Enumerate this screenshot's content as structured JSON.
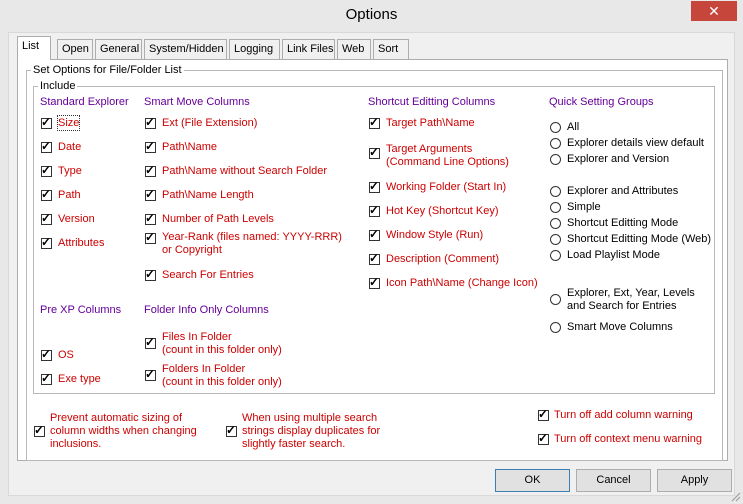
{
  "window": {
    "title": "Options",
    "close_glyph": "✕"
  },
  "tabs": [
    "List",
    "Open",
    "General",
    "System/Hidden",
    "Logging",
    "Link Files",
    "Web",
    "Sort"
  ],
  "group": {
    "title": "Set Options for File/Folder List",
    "include_title": "Include"
  },
  "standard_explorer": {
    "header": "Standard Explorer",
    "items": [
      {
        "label": "Size",
        "checked": true
      },
      {
        "label": "Date",
        "checked": true
      },
      {
        "label": "Type",
        "checked": true
      },
      {
        "label": "Path",
        "checked": true
      },
      {
        "label": "Version",
        "checked": true
      },
      {
        "label": "Attributes",
        "checked": true
      }
    ]
  },
  "smart_move": {
    "header": "Smart Move Columns",
    "items": [
      {
        "label": "Ext (File Extension)",
        "checked": true
      },
      {
        "label": "Path\\Name",
        "checked": true
      },
      {
        "label": "Path\\Name without Search Folder",
        "checked": true
      },
      {
        "label": "Path\\Name Length",
        "checked": true
      },
      {
        "label": "Number of Path Levels",
        "checked": true
      },
      {
        "label": "Year-Rank (files named: YYYY-RRR)",
        "label2": "or Copyright",
        "checked": true
      },
      {
        "label": "Search For Entries",
        "checked": true
      }
    ]
  },
  "shortcut_editing": {
    "header": "Shortcut Editting Columns",
    "items": [
      {
        "label": "Target Path\\Name",
        "checked": true
      },
      {
        "label": "Target Arguments",
        "label2": "(Command Line Options)",
        "checked": true
      },
      {
        "label": "Working Folder (Start In)",
        "checked": true
      },
      {
        "label": "Hot Key (Shortcut Key)",
        "checked": true
      },
      {
        "label": "Window Style (Run)",
        "checked": true
      },
      {
        "label": "Description (Comment)",
        "checked": true
      },
      {
        "label": "Icon Path\\Name (Change Icon)",
        "checked": true
      }
    ]
  },
  "quick_setting": {
    "header": "Quick Setting Groups",
    "items": [
      {
        "label": "All"
      },
      {
        "label": "Explorer details view default"
      },
      {
        "label": "Explorer and Version"
      },
      {
        "label": "Explorer and Attributes"
      },
      {
        "label": "Simple"
      },
      {
        "label": "Shortcut Editting Mode"
      },
      {
        "label": "Shortcut Editting Mode (Web)"
      },
      {
        "label": "Load Playlist Mode"
      },
      {
        "label": "Explorer, Ext, Year, Levels",
        "label2": "and Search for Entries"
      },
      {
        "label": "Smart Move Columns"
      }
    ]
  },
  "pre_xp": {
    "header": "Pre XP Columns",
    "items": [
      {
        "label": "OS",
        "checked": true
      },
      {
        "label": "Exe type",
        "checked": true
      }
    ]
  },
  "folder_info": {
    "header": "Folder Info Only Columns",
    "items": [
      {
        "label": "Files In Folder",
        "label2": "(count in this folder only)",
        "checked": true
      },
      {
        "label": "Folders In Folder",
        "label2": "(count in this folder only)",
        "checked": true
      }
    ]
  },
  "bottom_options": {
    "prevent_sizing": {
      "lines": [
        "Prevent automatic sizing of",
        "column widths when changing",
        "inclusions."
      ],
      "checked": true
    },
    "multi_search": {
      "lines": [
        "When using multiple search",
        "strings display duplicates for",
        "slightly  faster search."
      ],
      "checked": true
    },
    "add_column_warning": {
      "label": "Turn off add column warning",
      "checked": true
    },
    "context_menu_warning": {
      "label": "Turn off context menu warning",
      "checked": true
    }
  },
  "buttons": {
    "ok": "OK",
    "cancel": "Cancel",
    "apply": "Apply"
  }
}
